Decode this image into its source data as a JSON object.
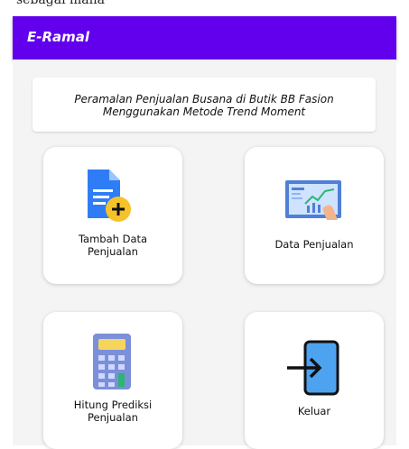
{
  "app": {
    "title": "E-Ramal"
  },
  "banner": {
    "line1": "Peramalan Penjualan Busana di Butik BB Fasion",
    "line2": "Menggunakan Metode Trend Moment"
  },
  "menu": [
    {
      "line1": "Tambah Data",
      "line2": "Penjualan",
      "icon": "add-document-icon"
    },
    {
      "line1": "Data Penjualan",
      "icon": "chart-board-icon"
    },
    {
      "line1": "Hitung Prediksi",
      "line2": "Penjualan",
      "icon": "calculator-icon"
    },
    {
      "line1": "Keluar",
      "icon": "logout-icon"
    }
  ],
  "colors": {
    "primary": "#6200ee",
    "background": "#f4f4f4",
    "card": "#ffffff"
  }
}
